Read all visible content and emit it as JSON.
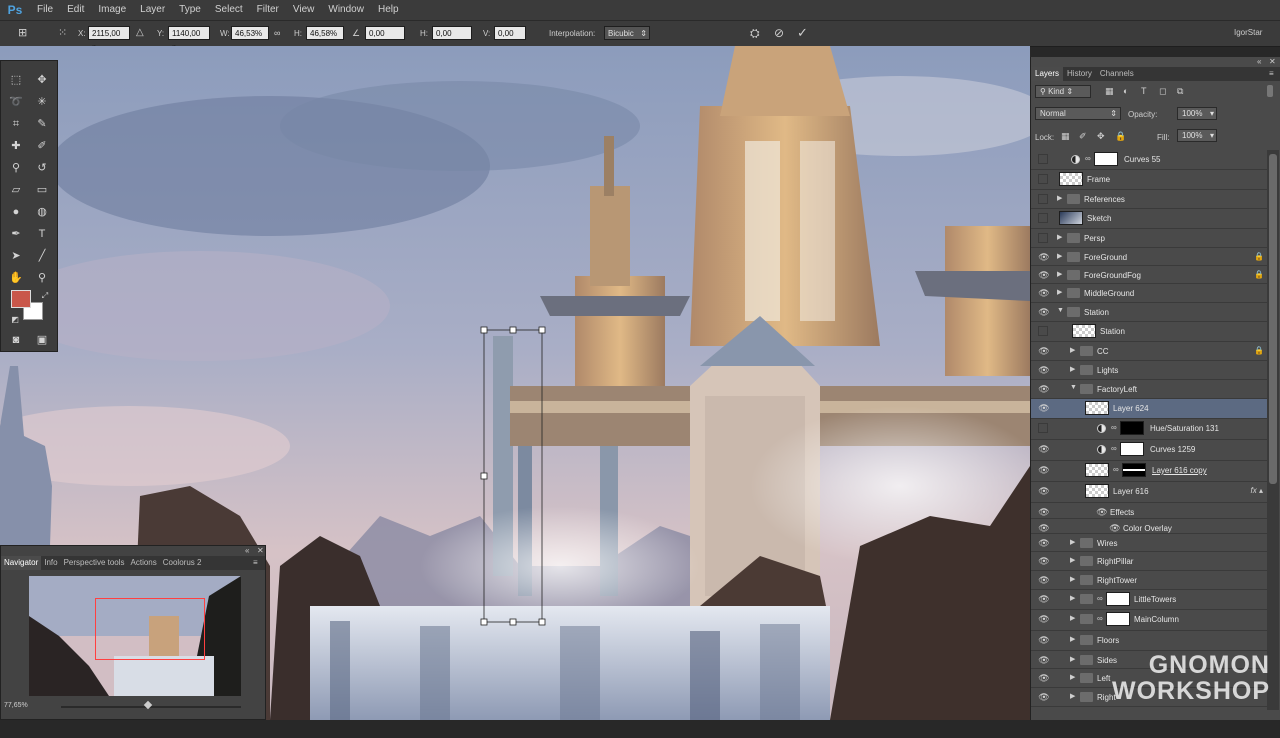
{
  "app_logo": "Ps",
  "menu": [
    "File",
    "Edit",
    "Image",
    "Layer",
    "Type",
    "Select",
    "Filter",
    "View",
    "Window",
    "Help"
  ],
  "options_bar": {
    "x_label": "X:",
    "x_value": "2115,00 p",
    "y_label": "Y:",
    "y_value": "1140,00 p",
    "w_label": "W:",
    "w_value": "46,53%",
    "h_label": "H:",
    "h_value": "46,58%",
    "angle_value": "0,00",
    "hskew_label": "H:",
    "hskew_value": "0,00",
    "vskew_label": "V:",
    "vskew_value": "0,00",
    "interpolation_label": "Interpolation:",
    "interpolation_value": "Bicubic",
    "user": "IgorStar"
  },
  "navigator": {
    "tabs": [
      "Navigator",
      "Info",
      "Perspective tools",
      "Actions",
      "Coolorus 2"
    ],
    "active_tab": 0,
    "zoom": "77,65%"
  },
  "layers_panel": {
    "tabs": [
      "Layers",
      "History",
      "Channels"
    ],
    "active_tab": 0,
    "filter_kind": "Kind",
    "blend_mode": "Normal",
    "opacity_label": "Opacity:",
    "opacity_value": "100%",
    "lock_label": "Lock:",
    "fill_label": "Fill:",
    "fill_value": "100%",
    "layers": [
      {
        "name": "Curves 55",
        "visible": false,
        "indent": 0,
        "kind": "adjustment-mask"
      },
      {
        "name": "Frame",
        "visible": false,
        "indent": 0,
        "kind": "pixel"
      },
      {
        "name": "References",
        "visible": false,
        "indent": 0,
        "kind": "group"
      },
      {
        "name": "Sketch",
        "visible": false,
        "indent": 0,
        "kind": "pixel-image"
      },
      {
        "name": "Persp",
        "visible": false,
        "indent": 0,
        "kind": "group"
      },
      {
        "name": "ForeGround",
        "visible": true,
        "indent": 0,
        "kind": "group",
        "locked": true
      },
      {
        "name": "ForeGroundFog",
        "visible": true,
        "indent": 0,
        "kind": "group",
        "locked": true
      },
      {
        "name": "MiddleGround",
        "visible": true,
        "indent": 0,
        "kind": "group"
      },
      {
        "name": "Station",
        "visible": true,
        "indent": 0,
        "kind": "group-open"
      },
      {
        "name": "Station",
        "visible": false,
        "indent": 1,
        "kind": "pixel"
      },
      {
        "name": "CC",
        "visible": true,
        "indent": 1,
        "kind": "group",
        "locked": true
      },
      {
        "name": "Lights",
        "visible": true,
        "indent": 1,
        "kind": "group"
      },
      {
        "name": "FactoryLeft",
        "visible": true,
        "indent": 1,
        "kind": "group-open"
      },
      {
        "name": "Layer 624",
        "visible": true,
        "indent": 2,
        "kind": "pixel",
        "selected": true
      },
      {
        "name": "Hue/Saturation 131",
        "visible": false,
        "indent": 2,
        "kind": "adjustment-black"
      },
      {
        "name": "Curves 1259",
        "visible": true,
        "indent": 2,
        "kind": "adjustment-mask"
      },
      {
        "name": "Layer 616 copy",
        "visible": true,
        "indent": 2,
        "kind": "pixel-mask"
      },
      {
        "name": "Layer 616",
        "visible": true,
        "indent": 2,
        "kind": "pixel",
        "fx": true
      },
      {
        "name": "Effects",
        "visible": true,
        "indent": 3,
        "kind": "effects"
      },
      {
        "name": "Color Overlay",
        "visible": true,
        "indent": 4,
        "kind": "effects"
      },
      {
        "name": "Wires",
        "visible": true,
        "indent": 1,
        "kind": "group"
      },
      {
        "name": "RightPillar",
        "visible": true,
        "indent": 1,
        "kind": "group"
      },
      {
        "name": "RightTower",
        "visible": true,
        "indent": 1,
        "kind": "group"
      },
      {
        "name": "LittleTowers",
        "visible": true,
        "indent": 1,
        "kind": "group-mask"
      },
      {
        "name": "MainColumn",
        "visible": true,
        "indent": 1,
        "kind": "group-mask"
      },
      {
        "name": "Floors",
        "visible": true,
        "indent": 1,
        "kind": "group"
      },
      {
        "name": "Sides",
        "visible": true,
        "indent": 1,
        "kind": "group"
      },
      {
        "name": "Left",
        "visible": true,
        "indent": 1,
        "kind": "group"
      },
      {
        "name": "Right",
        "visible": true,
        "indent": 1,
        "kind": "group"
      }
    ]
  },
  "foreground_color": "#c9574a",
  "background_color": "#ffffff",
  "watermark_line1": "GNOMON",
  "watermark_line2": "WORKSHOP"
}
